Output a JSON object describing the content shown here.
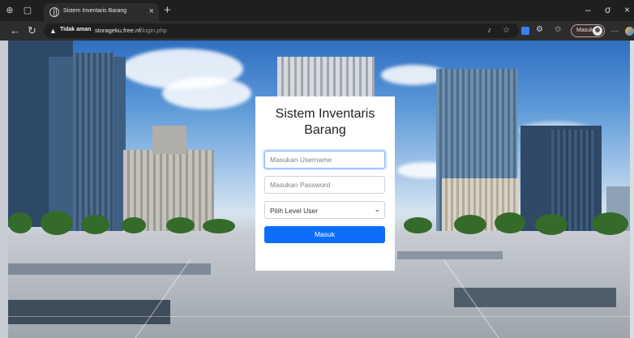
{
  "browser": {
    "tab_title": "Sistem Inventaris Barang",
    "tab_close": "×",
    "new_tab": "+",
    "security_label": "Tidak aman",
    "url_host": "storageku.free.nf",
    "url_path": "/login.php",
    "profile_label": "Masuk",
    "window_controls": {
      "minimize": "–",
      "maximize": "σ",
      "close": "×"
    },
    "icons": [
      "sidebar-icon",
      "workspaces-icon",
      "back-icon",
      "refresh-icon",
      "read-aloud-icon",
      "favorite-icon",
      "extension-icon",
      "settings-icon",
      "collections-icon",
      "menu-icon",
      "copilot-icon"
    ]
  },
  "login": {
    "title": "Sistem Inventaris Barang",
    "username_placeholder": "Masukan Username",
    "password_placeholder": "Masukan Password",
    "level_select": "Pilih Level User",
    "submit_label": "Masuk",
    "accent_color": "#0d6efd"
  }
}
